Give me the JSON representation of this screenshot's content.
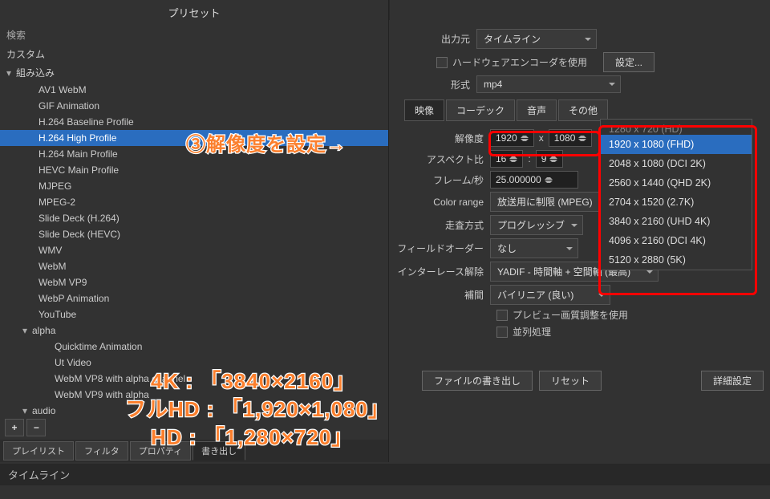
{
  "header": {
    "title": "書き出し"
  },
  "left": {
    "preset_title": "プリセット",
    "search_label": "検索",
    "groups": {
      "custom": "カスタム",
      "builtin": "組み込み",
      "alpha": "alpha",
      "audio": "audio"
    },
    "items": [
      "AV1 WebM",
      "GIF Animation",
      "H.264 Baseline Profile",
      "H.264 High Profile",
      "H.264 Main Profile",
      "HEVC Main Profile",
      "MJPEG",
      "MPEG-2",
      "Slide Deck (H.264)",
      "Slide Deck (HEVC)",
      "WMV",
      "WebM",
      "WebM VP9",
      "WebP Animation",
      "YouTube"
    ],
    "alpha_items": [
      "Quicktime Animation",
      "Ut Video",
      "WebM VP8 with alpha channel",
      "WebM VP9 with alpha"
    ],
    "buttons": {
      "add": "+",
      "remove": "−"
    },
    "tabs": [
      "プレイリスト",
      "フィルタ",
      "プロパティ",
      "書き出し"
    ],
    "timeline": "タイムライン"
  },
  "right": {
    "output_src_label": "出力元",
    "output_src_value": "タイムライン",
    "hw_encoder_label": "ハードウェアエンコーダを使用",
    "settings_btn": "設定...",
    "format_label": "形式",
    "format_value": "mp4",
    "tabs": [
      "映像",
      "コーデック",
      "音声",
      "その他"
    ],
    "fields": {
      "resolution_label": "解像度",
      "res_w": "1920",
      "res_x": "x",
      "res_h": "1080",
      "aspect_label": "アスペクト比",
      "aspect_w": "16",
      "aspect_sep": ":",
      "aspect_h": "9",
      "fps_label": "フレーム/秒",
      "fps_value": "25.000000",
      "colorrange_label": "Color range",
      "colorrange_value": "放送用に制限 (MPEG)",
      "scan_label": "走査方式",
      "scan_value": "プログレッシブ",
      "fieldorder_label": "フィールドオーダー",
      "fieldorder_value": "なし",
      "deint_label": "インターレース解除",
      "deint_value": "YADIF - 時間軸 + 空間軸 (最高)",
      "interp_label": "補間",
      "interp_value": "バイリニア (良い)",
      "preview_adj_label": "プレビュー画質調整を使用",
      "parallel_label": "並列処理",
      "reset_btn": "リセット",
      "export_file_btn": "ファイルの書き出し",
      "advanced_btn": "詳細設定"
    },
    "reso_popup": [
      "1280 x 720 (HD)",
      "1920 x 1080 (FHD)",
      "2048 x 1080 (DCI 2K)",
      "2560 x 1440 (QHD 2K)",
      "2704 x 1520 (2.7K)",
      "3840 x 2160 (UHD 4K)",
      "4096 x 2160 (DCI 4K)",
      "5120 x 2880 (5K)"
    ]
  },
  "annotations": {
    "step3": "③解像度を設定→",
    "line1": "4K : 「3840×2160」",
    "line2": "フルHD : 「1,920×1,080」",
    "line3": "HD : 「1,280×720」"
  }
}
